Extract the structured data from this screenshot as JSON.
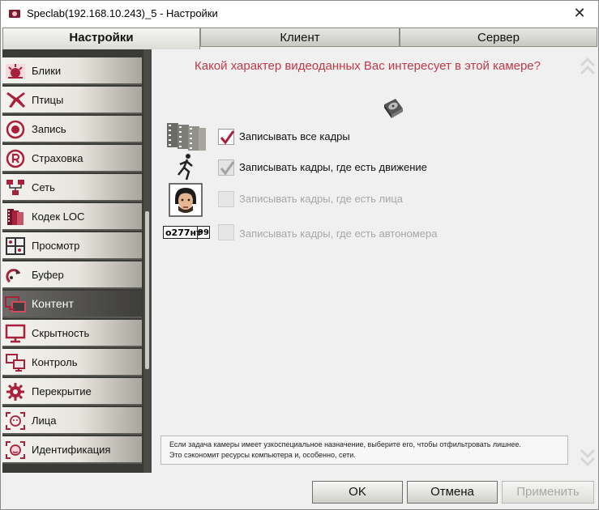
{
  "window": {
    "title": "Speclab(192.168.10.243)_5 - Настройки",
    "close_symbol": "✕"
  },
  "tabs": [
    {
      "label": "Настройки",
      "active": true
    },
    {
      "label": "Клиент",
      "active": false
    },
    {
      "label": "Сервер",
      "active": false
    }
  ],
  "sidebar": {
    "items": [
      {
        "label": "Блики",
        "icon": "glare-icon"
      },
      {
        "label": "Птицы",
        "icon": "bird-icon"
      },
      {
        "label": "Запись",
        "icon": "record-icon"
      },
      {
        "label": "Страховка",
        "icon": "insurance-r-icon"
      },
      {
        "label": "Сеть",
        "icon": "network-icon"
      },
      {
        "label": "Кодек LOC",
        "icon": "film-codec-icon"
      },
      {
        "label": "Просмотр",
        "icon": "view-grid-icon"
      },
      {
        "label": "Буфер",
        "icon": "buffer-icon"
      },
      {
        "label": "Контент",
        "icon": "content-monitor-icon",
        "active": true
      },
      {
        "label": "Скрытность",
        "icon": "monitor-icon"
      },
      {
        "label": "Контроль",
        "icon": "control-monitors-icon"
      },
      {
        "label": "Перекрытие",
        "icon": "gear-icon"
      },
      {
        "label": "Лица",
        "icon": "face-frame-icon"
      },
      {
        "label": "Идентификация",
        "icon": "face-id-icon"
      }
    ]
  },
  "main": {
    "question": "Какой характер видеоданных Вас интересует в этой камере?",
    "options": [
      {
        "label": "Записывать все кадры",
        "checked": true,
        "enabled": true,
        "icon": "film-stack-icon"
      },
      {
        "label": "Записывать кадры, где есть движение",
        "checked": true,
        "enabled": false,
        "icon": "running-man-icon"
      },
      {
        "label": "Записывать кадры, где есть лица",
        "checked": false,
        "enabled": false,
        "icon": "face-photo-icon"
      },
      {
        "label": "Записывать кадры, где есть автономера",
        "checked": false,
        "enabled": false,
        "icon": "license-plate-icon"
      }
    ],
    "plate": {
      "number": "o277нт",
      "region": "99"
    },
    "hint_line1": "Если задача камеры имеет узкоспециальное назначение, выберите его, чтобы отфильтровать лишнее.",
    "hint_line2": "Это сэкономит ресурсы компьютера и, особенно, сети."
  },
  "buttons": {
    "ok": "OK",
    "cancel": "Отмена",
    "apply": "Применить"
  },
  "colors": {
    "question": "#c0394b",
    "accent": "#a8203a",
    "sidebar_active": "#3e3d3a"
  }
}
